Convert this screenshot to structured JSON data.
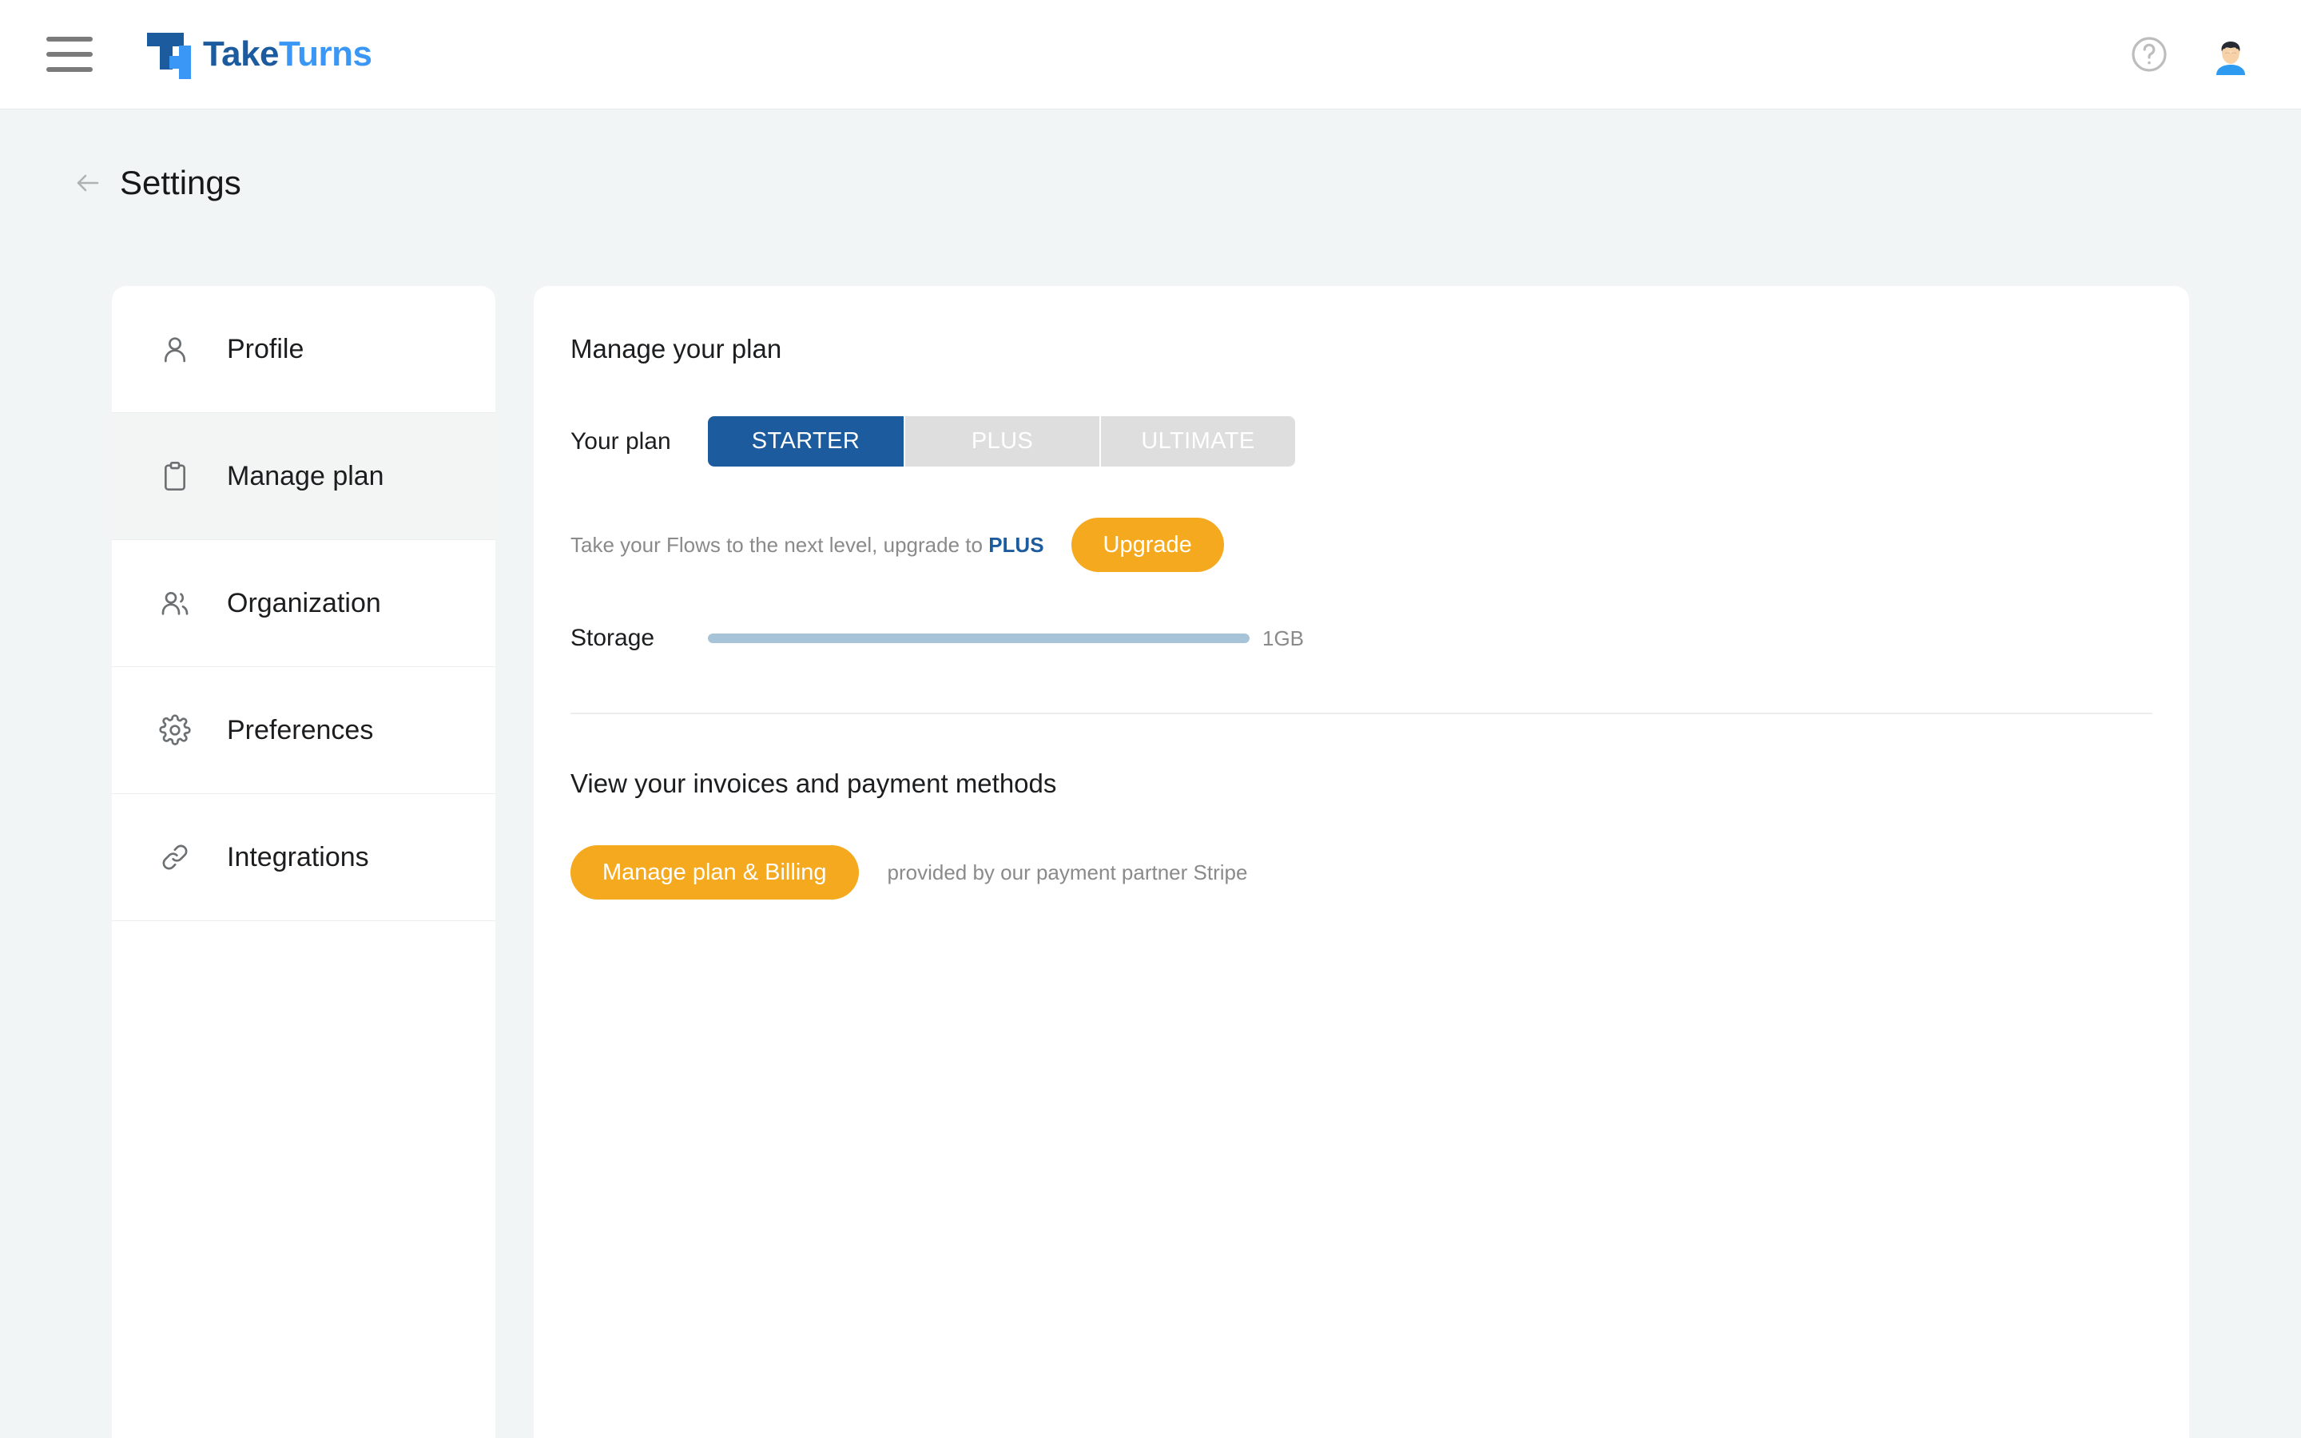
{
  "topbar": {
    "menu_icon": "hamburger-menu-icon",
    "brand_name_part1": "Take",
    "brand_name_part2": "Turns",
    "help_icon": "help-circle-icon",
    "avatar_icon": "user-avatar"
  },
  "page": {
    "back_icon": "arrow-left-icon",
    "title": "Settings"
  },
  "sidebar": {
    "items": [
      {
        "label": "Profile",
        "icon": "user-icon",
        "active": false
      },
      {
        "label": "Manage plan",
        "icon": "clipboard-icon",
        "active": true
      },
      {
        "label": "Organization",
        "icon": "users-icon",
        "active": false
      },
      {
        "label": "Preferences",
        "icon": "gear-icon",
        "active": false
      },
      {
        "label": "Integrations",
        "icon": "link-chain-icon",
        "active": false
      }
    ]
  },
  "main": {
    "plan_section_title": "Manage your plan",
    "plan_row_label": "Your plan",
    "plans": [
      {
        "label": "STARTER",
        "selected": true
      },
      {
        "label": "PLUS",
        "selected": false
      },
      {
        "label": "ULTIMATE",
        "selected": false
      }
    ],
    "upsell_prefix": "Take your Flows to the next level, upgrade to ",
    "upsell_plan": "PLUS",
    "upgrade_button": "Upgrade",
    "storage_label": "Storage",
    "storage_value": "1GB",
    "storage_percent": 100,
    "billing_section_title": "View your invoices and payment methods",
    "billing_button": "Manage plan & Billing",
    "billing_note": "provided by our payment partner Stripe"
  },
  "colors": {
    "brand_dark_blue": "#1c5c9e",
    "brand_light_blue": "#3b97f5",
    "accent_orange": "#f5a91e",
    "storage_bar": "#a7c3d8",
    "segment_inactive": "#dedede",
    "page_background": "#f2f5f5"
  }
}
